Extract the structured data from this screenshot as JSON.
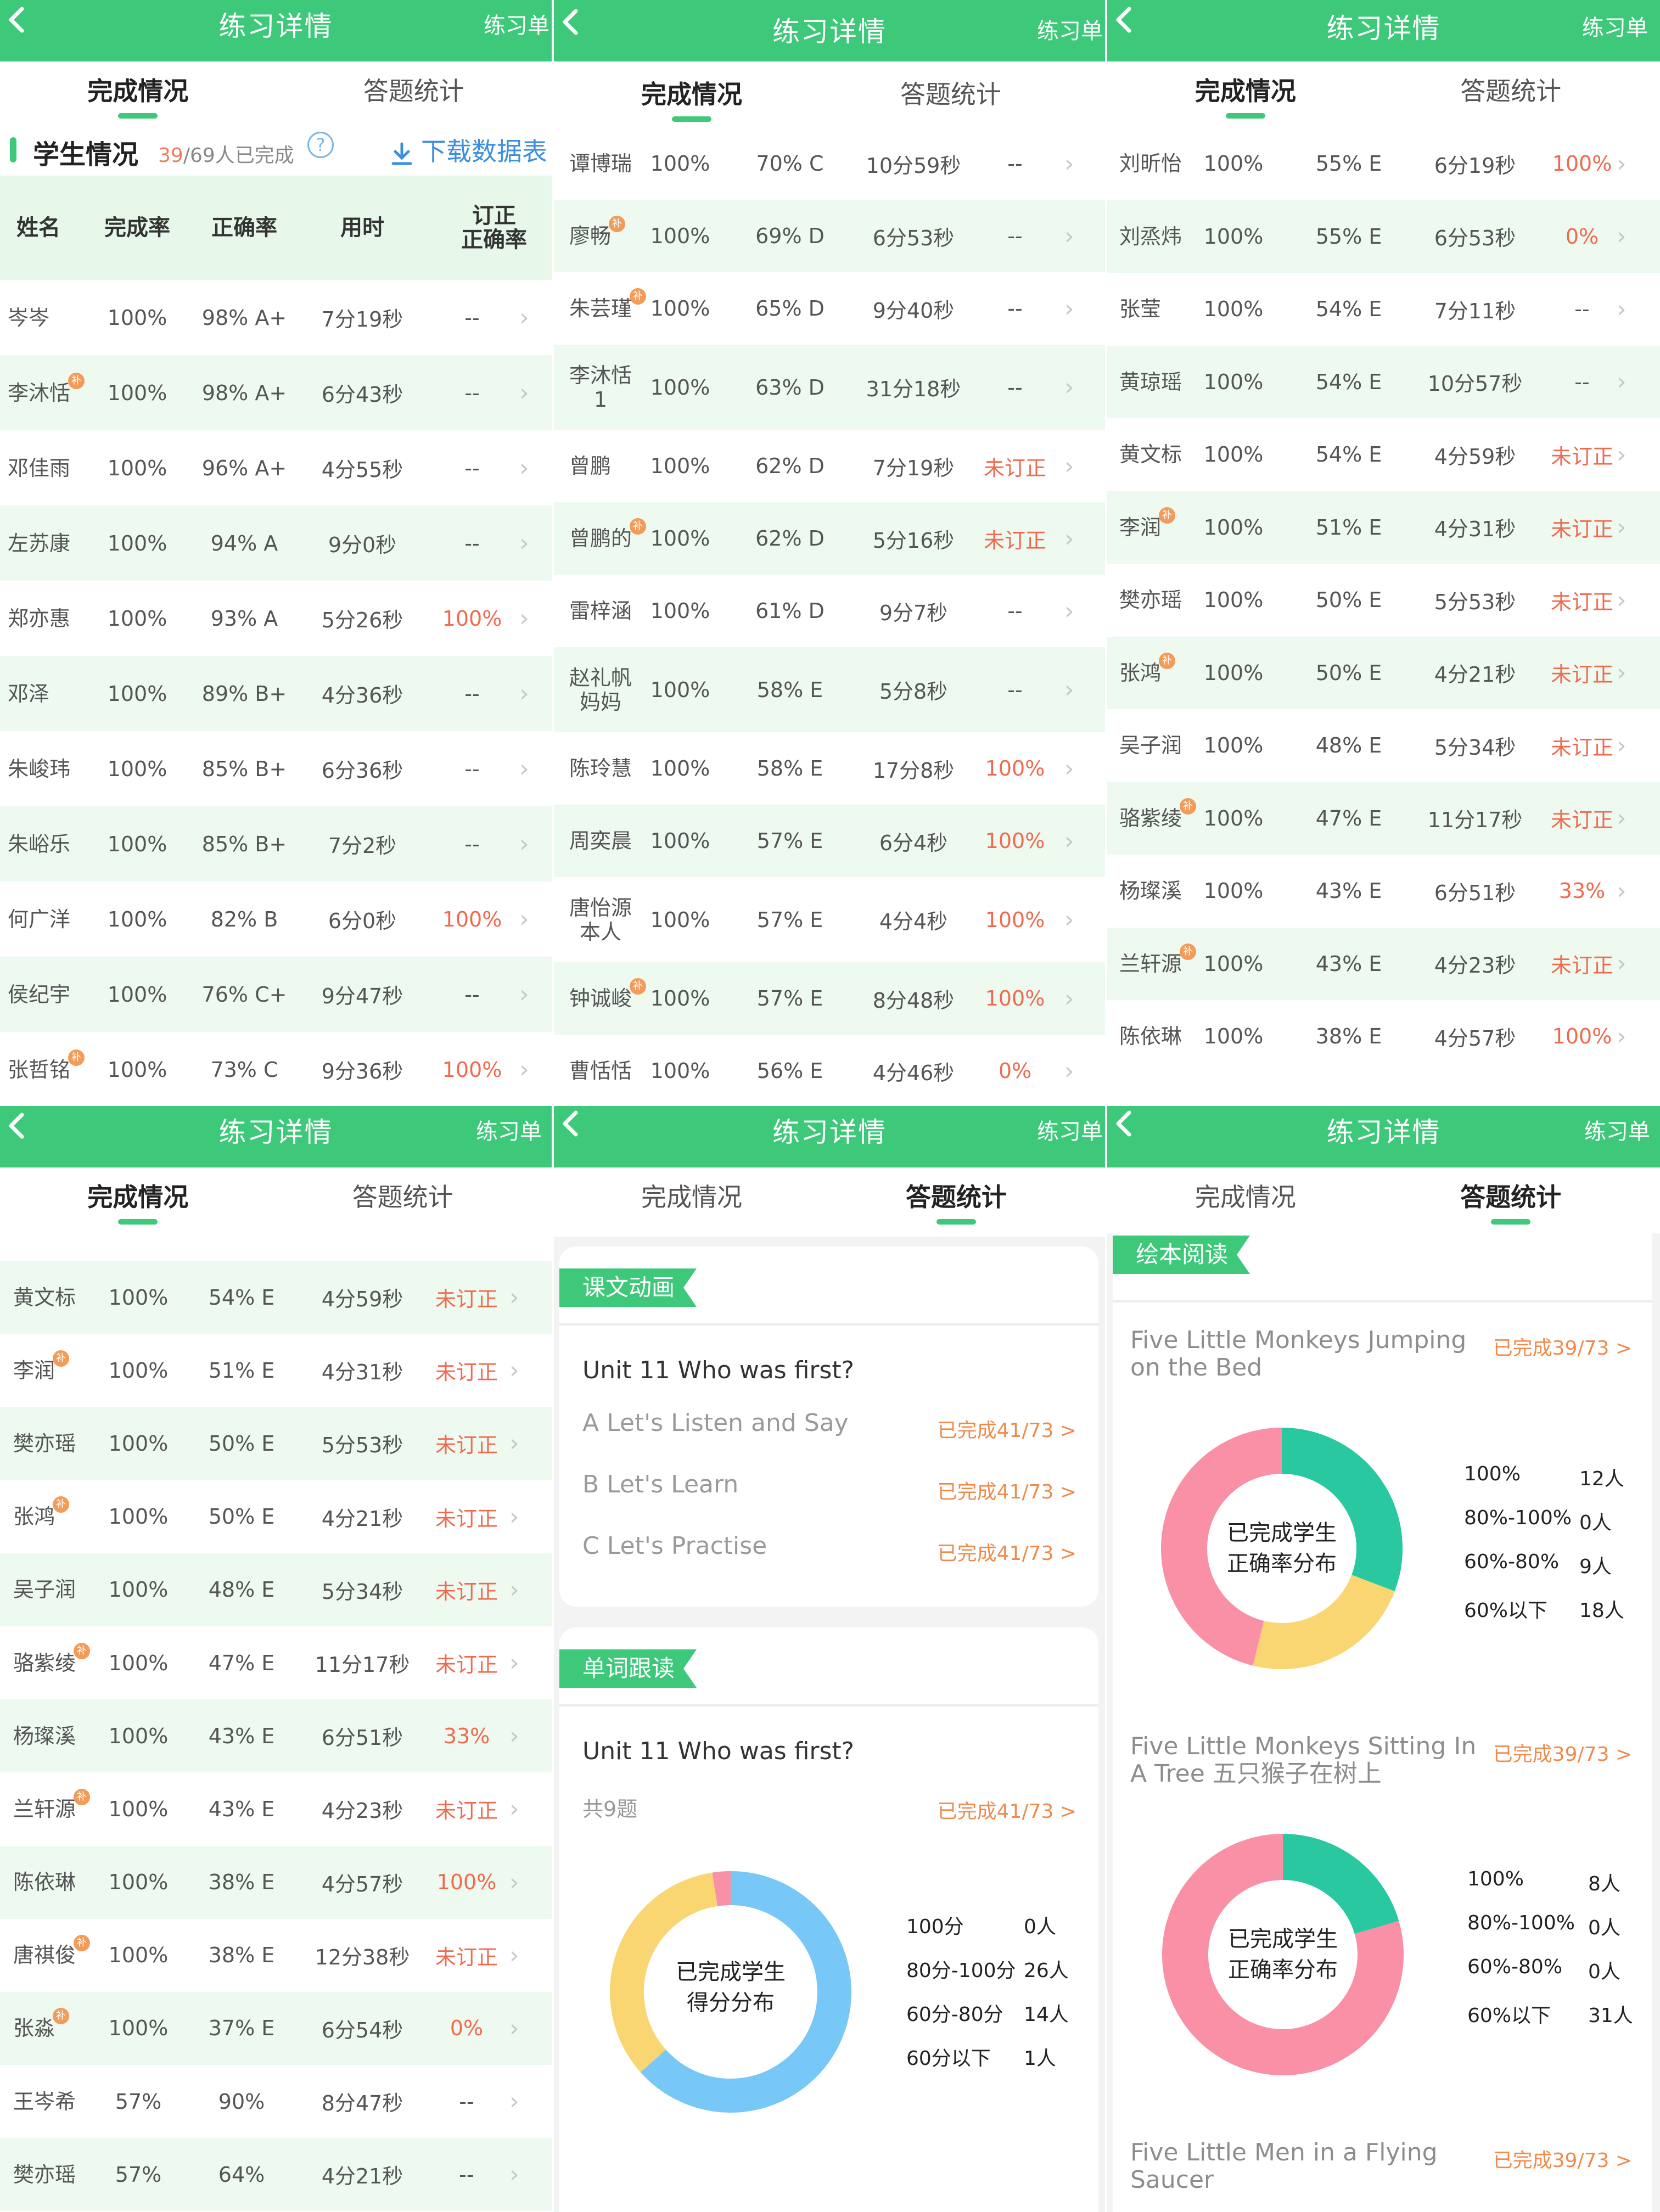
{
  "common": {
    "title": "练习详情",
    "right_label": "练习单",
    "tab_completion": "完成情况",
    "tab_stats": "答题统计",
    "chevron": "›"
  },
  "panel1": {
    "section_label": "学生情况",
    "done_count": "39",
    "total_text": "/69人已完成",
    "help": "?",
    "download": "下载数据表",
    "headers": [
      "姓名",
      "完成率",
      "正确率",
      "用时",
      "订正\n正确率"
    ]
  },
  "rows_p1": [
    {
      "name": "岑岑",
      "rate": "100%",
      "acc": "98% A+",
      "time": "7分19秒",
      "fix": "--",
      "red": false,
      "badge": false
    },
    {
      "name": "李沐恬",
      "rate": "100%",
      "acc": "98% A+",
      "time": "6分43秒",
      "fix": "--",
      "red": false,
      "badge": true
    },
    {
      "name": "邓佳雨",
      "rate": "100%",
      "acc": "96% A+",
      "time": "4分55秒",
      "fix": "--",
      "red": false,
      "badge": false
    },
    {
      "name": "左苏康",
      "rate": "100%",
      "acc": "94% A",
      "time": "9分0秒",
      "fix": "--",
      "red": false,
      "badge": false
    },
    {
      "name": "郑亦惠",
      "rate": "100%",
      "acc": "93% A",
      "time": "5分26秒",
      "fix": "100%",
      "red": true,
      "badge": false
    },
    {
      "name": "邓泽",
      "rate": "100%",
      "acc": "89% B+",
      "time": "4分36秒",
      "fix": "--",
      "red": false,
      "badge": false
    },
    {
      "name": "朱峻玮",
      "rate": "100%",
      "acc": "85% B+",
      "time": "6分36秒",
      "fix": "--",
      "red": false,
      "badge": false
    },
    {
      "name": "朱峪乐",
      "rate": "100%",
      "acc": "85% B+",
      "time": "7分2秒",
      "fix": "--",
      "red": false,
      "badge": false
    },
    {
      "name": "何广洋",
      "rate": "100%",
      "acc": "82% B",
      "time": "6分0秒",
      "fix": "100%",
      "red": true,
      "badge": false
    },
    {
      "name": "侯纪宇",
      "rate": "100%",
      "acc": "76% C+",
      "time": "9分47秒",
      "fix": "--",
      "red": false,
      "badge": false
    },
    {
      "name": "张哲铭",
      "rate": "100%",
      "acc": "73% C",
      "time": "9分36秒",
      "fix": "100%",
      "red": true,
      "badge": true
    }
  ],
  "rows_p2": [
    {
      "name": "谭博瑞",
      "rate": "100%",
      "acc": "70% C",
      "time": "10分59秒",
      "fix": "--",
      "red": false,
      "badge": false
    },
    {
      "name": "廖畅",
      "rate": "100%",
      "acc": "69% D",
      "time": "6分53秒",
      "fix": "--",
      "red": false,
      "badge": true
    },
    {
      "name": "朱芸瑾",
      "rate": "100%",
      "acc": "65% D",
      "time": "9分40秒",
      "fix": "--",
      "red": false,
      "badge": true
    },
    {
      "name": "李沐恬 1",
      "rate": "100%",
      "acc": "63% D",
      "time": "31分18秒",
      "fix": "--",
      "red": false,
      "badge": false
    },
    {
      "name": "曾鹏",
      "rate": "100%",
      "acc": "62% D",
      "time": "7分19秒",
      "fix": "未订正",
      "red": true,
      "badge": false
    },
    {
      "name": "曾鹏的",
      "rate": "100%",
      "acc": "62% D",
      "time": "5分16秒",
      "fix": "未订正",
      "red": true,
      "badge": true
    },
    {
      "name": "雷梓涵",
      "rate": "100%",
      "acc": "61% D",
      "time": "9分7秒",
      "fix": "--",
      "red": false,
      "badge": false
    },
    {
      "name": "赵礼帆 妈妈",
      "rate": "100%",
      "acc": "58% E",
      "time": "5分8秒",
      "fix": "--",
      "red": false,
      "badge": false
    },
    {
      "name": "陈玲慧",
      "rate": "100%",
      "acc": "58% E",
      "time": "17分8秒",
      "fix": "100%",
      "red": true,
      "badge": false
    },
    {
      "name": "周奕晨",
      "rate": "100%",
      "acc": "57% E",
      "time": "6分4秒",
      "fix": "100%",
      "red": true,
      "badge": false
    },
    {
      "name": "唐怡源 本人",
      "rate": "100%",
      "acc": "57% E",
      "time": "4分4秒",
      "fix": "100%",
      "red": true,
      "badge": false
    },
    {
      "name": "钟诚峻",
      "rate": "100%",
      "acc": "57% E",
      "time": "8分48秒",
      "fix": "100%",
      "red": true,
      "badge": true
    },
    {
      "name": "曹恬恬",
      "rate": "100%",
      "acc": "56% E",
      "time": "4分46秒",
      "fix": "0%",
      "red": true,
      "badge": false
    }
  ],
  "rows_p3": [
    {
      "name": "刘昕怡",
      "rate": "100%",
      "acc": "55% E",
      "time": "6分19秒",
      "fix": "100%",
      "red": true,
      "badge": false
    },
    {
      "name": "刘烝炜",
      "rate": "100%",
      "acc": "55% E",
      "time": "6分53秒",
      "fix": "0%",
      "red": true,
      "badge": false
    },
    {
      "name": "张莹",
      "rate": "100%",
      "acc": "54% E",
      "time": "7分11秒",
      "fix": "--",
      "red": false,
      "badge": false
    },
    {
      "name": "黄琼瑶",
      "rate": "100%",
      "acc": "54% E",
      "time": "10分57秒",
      "fix": "--",
      "red": false,
      "badge": false
    },
    {
      "name": "黄文标",
      "rate": "100%",
      "acc": "54% E",
      "time": "4分59秒",
      "fix": "未订正",
      "red": true,
      "badge": false
    },
    {
      "name": "李润",
      "rate": "100%",
      "acc": "51% E",
      "time": "4分31秒",
      "fix": "未订正",
      "red": true,
      "badge": true
    },
    {
      "name": "樊亦瑶",
      "rate": "100%",
      "acc": "50% E",
      "time": "5分53秒",
      "fix": "未订正",
      "red": true,
      "badge": false
    },
    {
      "name": "张鸿",
      "rate": "100%",
      "acc": "50% E",
      "time": "4分21秒",
      "fix": "未订正",
      "red": true,
      "badge": true
    },
    {
      "name": "吴子润",
      "rate": "100%",
      "acc": "48% E",
      "time": "5分34秒",
      "fix": "未订正",
      "red": true,
      "badge": false
    },
    {
      "name": "骆紫绫",
      "rate": "100%",
      "acc": "47% E",
      "time": "11分17秒",
      "fix": "未订正",
      "red": true,
      "badge": true
    },
    {
      "name": "杨璨溪",
      "rate": "100%",
      "acc": "43% E",
      "time": "6分51秒",
      "fix": "33%",
      "red": true,
      "badge": false
    },
    {
      "name": "兰轩源",
      "rate": "100%",
      "acc": "43% E",
      "time": "4分23秒",
      "fix": "未订正",
      "red": true,
      "badge": true
    },
    {
      "name": "陈依琳",
      "rate": "100%",
      "acc": "38% E",
      "time": "4分57秒",
      "fix": "100%",
      "red": true,
      "badge": false
    }
  ],
  "rows_p4": [
    {
      "name": "黄文标",
      "rate": "100%",
      "acc": "54% E",
      "time": "4分59秒",
      "fix": "未订正",
      "red": true,
      "badge": false
    },
    {
      "name": "李润",
      "rate": "100%",
      "acc": "51% E",
      "time": "4分31秒",
      "fix": "未订正",
      "red": true,
      "badge": true
    },
    {
      "name": "樊亦瑶",
      "rate": "100%",
      "acc": "50% E",
      "time": "5分53秒",
      "fix": "未订正",
      "red": true,
      "badge": false
    },
    {
      "name": "张鸿",
      "rate": "100%",
      "acc": "50% E",
      "time": "4分21秒",
      "fix": "未订正",
      "red": true,
      "badge": true
    },
    {
      "name": "吴子润",
      "rate": "100%",
      "acc": "48% E",
      "time": "5分34秒",
      "fix": "未订正",
      "red": true,
      "badge": false
    },
    {
      "name": "骆紫绫",
      "rate": "100%",
      "acc": "47% E",
      "time": "11分17秒",
      "fix": "未订正",
      "red": true,
      "badge": true
    },
    {
      "name": "杨璨溪",
      "rate": "100%",
      "acc": "43% E",
      "time": "6分51秒",
      "fix": "33%",
      "red": true,
      "badge": false
    },
    {
      "name": "兰轩源",
      "rate": "100%",
      "acc": "43% E",
      "time": "4分23秒",
      "fix": "未订正",
      "red": true,
      "badge": true
    },
    {
      "name": "陈依琳",
      "rate": "100%",
      "acc": "38% E",
      "time": "4分57秒",
      "fix": "100%",
      "red": true,
      "badge": false
    },
    {
      "name": "唐祺俊",
      "rate": "100%",
      "acc": "38% E",
      "time": "12分38秒",
      "fix": "未订正",
      "red": true,
      "badge": true
    },
    {
      "name": "张淼",
      "rate": "100%",
      "acc": "37% E",
      "time": "6分54秒",
      "fix": "0%",
      "red": true,
      "badge": true
    },
    {
      "name": "王岑希",
      "rate": "57%",
      "acc": "90%",
      "time": "8分47秒",
      "fix": "--",
      "red": false,
      "badge": false
    },
    {
      "name": "樊亦瑶",
      "rate": "57%",
      "acc": "64%",
      "time": "4分21秒",
      "fix": "--",
      "red": false,
      "badge": false
    }
  ],
  "panel5": {
    "section1": "课文动画",
    "unit1": "Unit 11 Who was first?",
    "items": [
      {
        "label": "A Let's Listen and Say",
        "status": "已完成41/73 >"
      },
      {
        "label": "B Let's Learn",
        "status": "已完成41/73 >"
      },
      {
        "label": "C Let's Practise",
        "status": "已完成41/73 >"
      }
    ],
    "section2": "单词跟读",
    "unit2": "Unit 11 Who was first?",
    "question_count": "共9题",
    "status2": "已完成41/73 >",
    "donut_center": "已完成学生\n得分分布",
    "legend": [
      {
        "label": "100分",
        "count": "0人"
      },
      {
        "label": "80分-100分",
        "count": "26人"
      },
      {
        "label": "60分-80分",
        "count": "14人"
      },
      {
        "label": "60分以下",
        "count": "1人"
      }
    ]
  },
  "panel6": {
    "section": "绘本阅读",
    "book1": "Five Little Monkeys Jumping on the Bed",
    "book1_status": "已完成39/73 >",
    "book2": "Five Little Monkeys Sitting In A Tree 五只猴子在树上",
    "book2_status": "已完成39/73 >",
    "book3": "Five Little Men in a Flying Saucer",
    "book3_status": "已完成39/73 >",
    "donut_center": "已完成学生\n正确率分布",
    "legend1": [
      {
        "label": "100%",
        "count": "12人"
      },
      {
        "label": "80%-100%",
        "count": "0人"
      },
      {
        "label": "60%-80%",
        "count": "9人"
      },
      {
        "label": "60%以下",
        "count": "18人"
      }
    ],
    "legend2": [
      {
        "label": "100%",
        "count": "8人"
      },
      {
        "label": "80%-100%",
        "count": "0人"
      },
      {
        "label": "60%-80%",
        "count": "0人"
      },
      {
        "label": "60%以下",
        "count": "31人"
      }
    ]
  },
  "colors": {
    "green": "#3ec97a",
    "teal": "#2ac8a0",
    "yellow": "#fad673",
    "pink": "#fa90a5",
    "blue": "#77c7f7",
    "orange": "#f08a4b",
    "red": "#f06a4e"
  },
  "chart_data": [
    {
      "type": "pie",
      "categories": [
        "100分",
        "80分-100分",
        "60分-80分",
        "60分以下"
      ],
      "values": [
        0,
        26,
        14,
        1
      ]
    },
    {
      "type": "pie",
      "categories": [
        "100%",
        "80%-100%",
        "60%-80%",
        "60%以下"
      ],
      "values": [
        12,
        0,
        9,
        18
      ]
    },
    {
      "type": "pie",
      "categories": [
        "100%",
        "80%-100%",
        "60%-80%",
        "60%以下"
      ],
      "values": [
        8,
        0,
        0,
        31
      ]
    }
  ]
}
